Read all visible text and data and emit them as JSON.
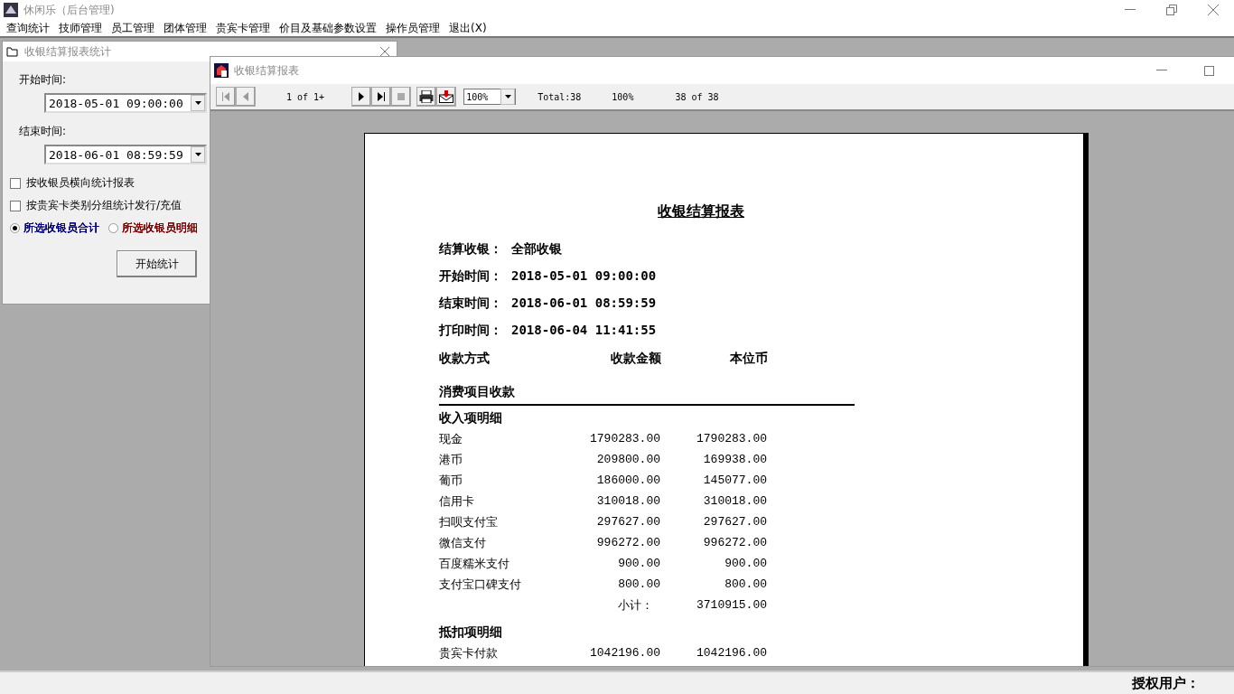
{
  "window": {
    "title": "休闲乐（后台管理)"
  },
  "menu": [
    "查询统计",
    "技师管理",
    "员工管理",
    "团体管理",
    "贵宾卡管理",
    "价目及基础参数设置",
    "操作员管理",
    "退出(X)"
  ],
  "query_window": {
    "title": "收银结算报表统计",
    "start_label": "开始时间:",
    "start_value": "2018-05-01 09:00:00",
    "end_label": "结束时间:",
    "end_value": "2018-06-01 08:59:59",
    "options": [
      {
        "label": "按收银员横向统计报表",
        "checked": false
      },
      {
        "label": "按贵宾卡类别分组统计发行/充值",
        "checked": false
      }
    ],
    "radios": [
      {
        "label": "所选收银员合计",
        "selected": true,
        "color": "#000080"
      },
      {
        "label": "所选收银员明细",
        "selected": false,
        "color": "#800000"
      }
    ],
    "button": "开始统计"
  },
  "report_window": {
    "title": "收银结算报表",
    "toolbar": {
      "page_info": "1 of 1+",
      "zoom": "100%",
      "total": "Total:38",
      "percent": "100%",
      "count": "38 of 38"
    },
    "page": {
      "title": "收银结算报表",
      "header_lines": [
        {
          "label": "结算收银：",
          "value": "全部收银"
        },
        {
          "label": "开始时间：",
          "value": "2018-05-01 09:00:00"
        },
        {
          "label": "结束时间：",
          "value": "2018-06-01 08:59:59"
        },
        {
          "label": "打印时间：",
          "value": "2018-06-04 11:41:55"
        }
      ],
      "columns": [
        "收款方式",
        "收款金额",
        "本位币"
      ],
      "section": "消费项目收款",
      "groups": [
        {
          "title": "收入项明细",
          "rows": [
            {
              "name": "现金",
              "amount": "1790283.00",
              "local": "1790283.00"
            },
            {
              "name": "港币",
              "amount": "209800.00",
              "local": "169938.00"
            },
            {
              "name": "葡币",
              "amount": "186000.00",
              "local": "145077.00"
            },
            {
              "name": "信用卡",
              "amount": "310018.00",
              "local": "310018.00"
            },
            {
              "name": "扫呗支付宝",
              "amount": "297627.00",
              "local": "297627.00"
            },
            {
              "name": "微信支付",
              "amount": "996272.00",
              "local": "996272.00"
            },
            {
              "name": "百度糯米支付",
              "amount": "900.00",
              "local": "900.00"
            },
            {
              "name": "支付宝口碑支付",
              "amount": "800.00",
              "local": "800.00"
            }
          ],
          "subtotal": {
            "label": "小计：",
            "value": "3710915.00"
          }
        },
        {
          "title": "抵扣项明细",
          "rows": [
            {
              "name": "贵宾卡付款",
              "amount": "1042196.00",
              "local": "1042196.00"
            }
          ]
        }
      ]
    }
  },
  "status_bar": {
    "label": "授权用户："
  }
}
